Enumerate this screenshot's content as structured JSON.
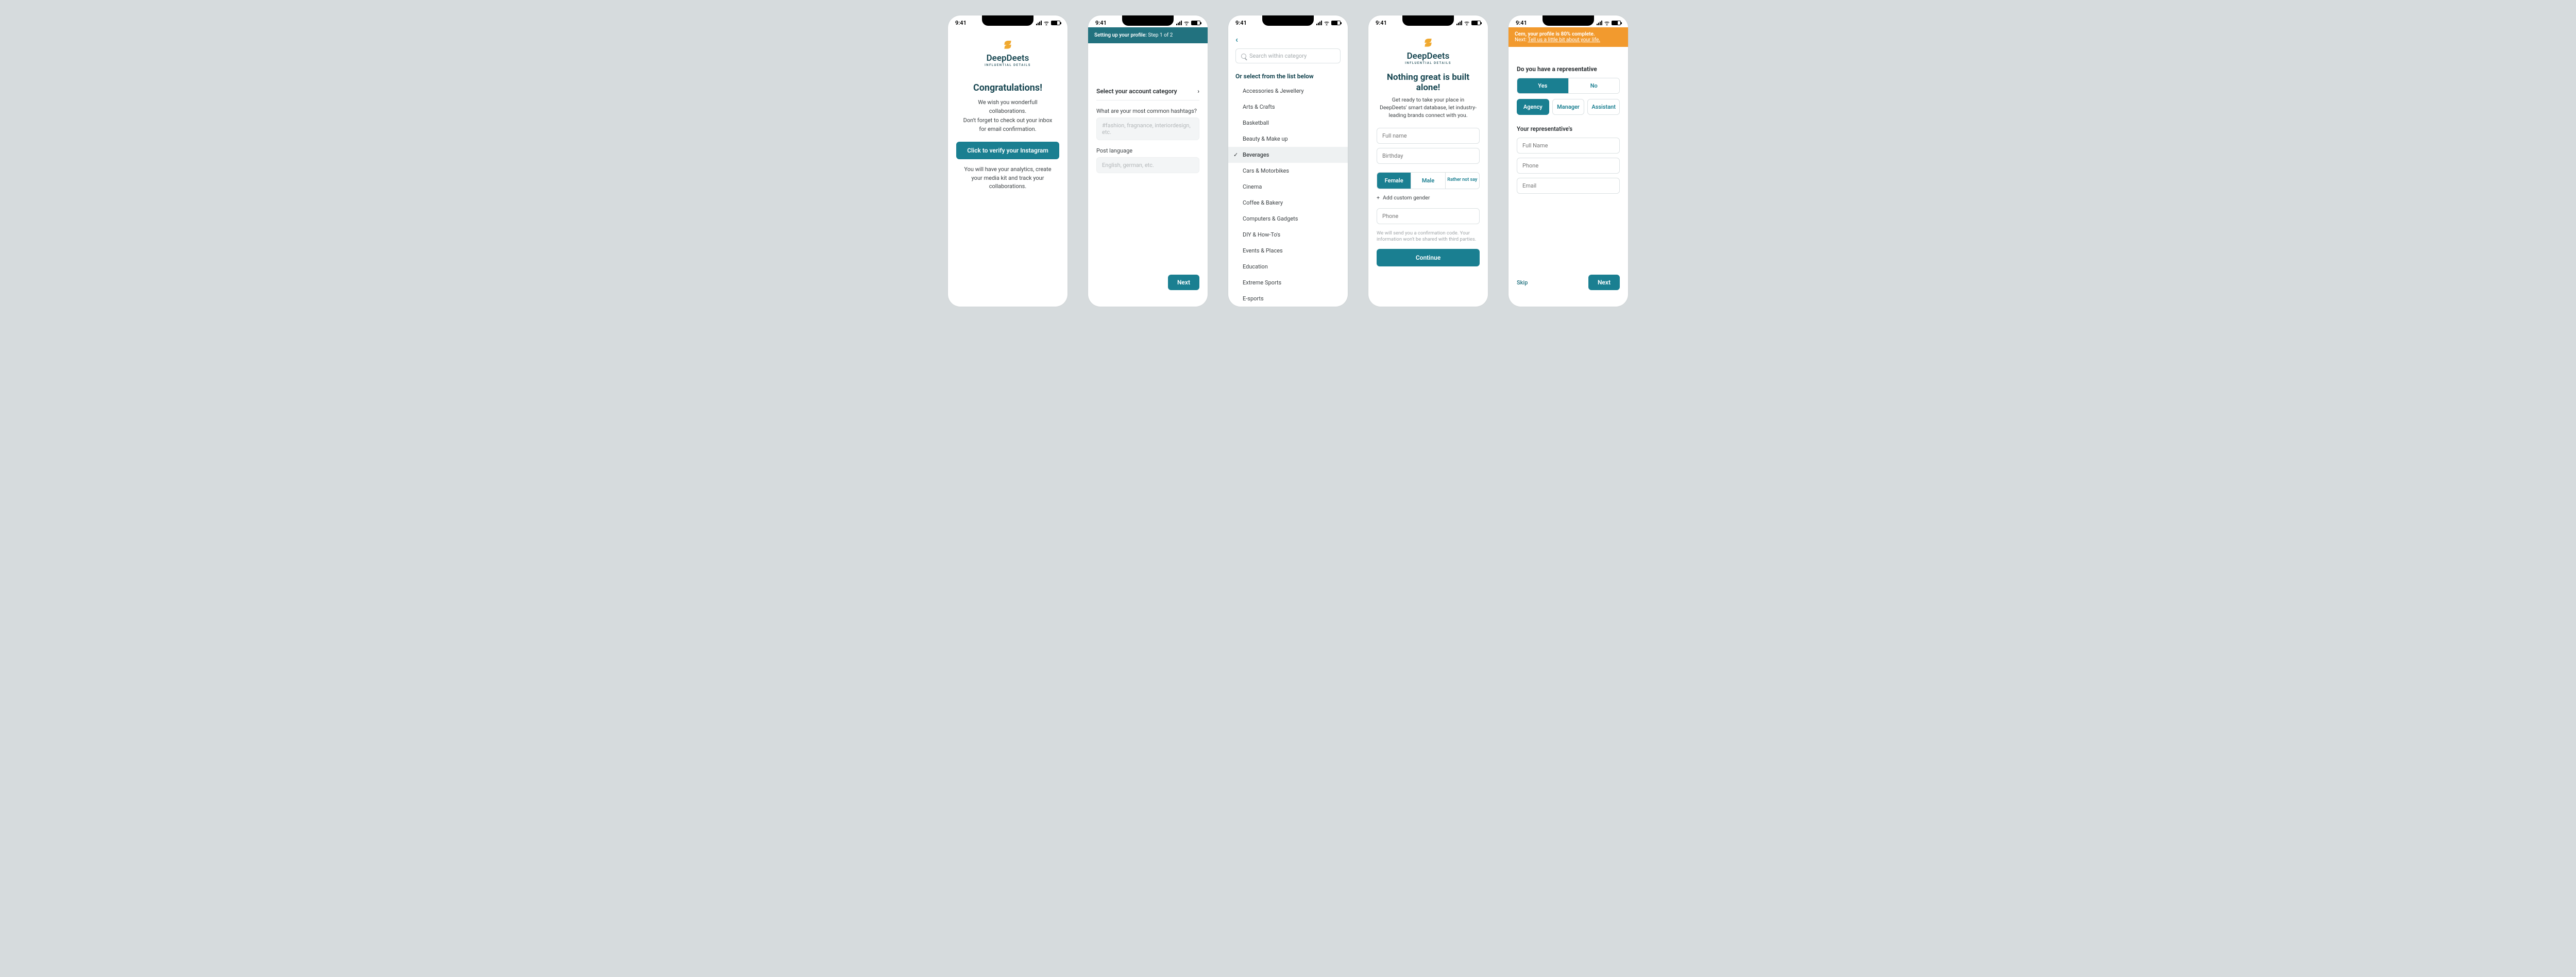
{
  "statusbar": {
    "time": "9:41"
  },
  "brand": {
    "name": "DeepDeets",
    "tagline": "INFLUENTIAL DETAILS"
  },
  "screen1": {
    "title": "Congratulations!",
    "line1": "We wish you wonderfull collaborations.",
    "line2": "Don't forget to check out your inbox for email confirmation.",
    "cta": "Click to verify your Instagram",
    "sub": "You will have your analytics, create your media kit and track your collaborations."
  },
  "screen2": {
    "bar_prefix": "Setting up your profile:",
    "bar_step": "Step 1 of 2",
    "row_label": "Select your account category",
    "hashtags_label": "What are your most common hashtags?",
    "hashtags_ph": "#fashion, fragnance, interiordesign, etc.",
    "lang_label": "Post language",
    "lang_ph": "English, german, etc.",
    "next": "Next"
  },
  "screen3": {
    "search_ph": "Search within category",
    "subhead": "Or select from the list below",
    "selected": "Beverages",
    "items": [
      "Accessories & Jewellery",
      "Arts & Crafts",
      "Basketball",
      "Beauty & Make up",
      "Beverages",
      "Cars & Motorbikes",
      "Cinema",
      "Coffee & Bakery",
      "Computers & Gadgets",
      "DIY & How-To's",
      "Events & Places",
      "Education",
      "Extreme Sports",
      "E-sports"
    ]
  },
  "screen4": {
    "title": "Nothing great is built alone!",
    "subtitle": "Get ready to take your place in DeepDeets' smart database, let industry-leading brands connect with you.",
    "fullname_ph": "Full name",
    "birthday_ph": "Birthday",
    "gender": {
      "female": "Female",
      "male": "Male",
      "rns": "Rather not say"
    },
    "add_gender": "Add custom gender",
    "phone_ph": "Phone",
    "hint": "We will send you a confirmation code. Your information won't be shared with third parties.",
    "continue": "Continue"
  },
  "screen5": {
    "banner_line1": "Cem, your profile is 80% complete.",
    "banner_next_prefix": "Next: ",
    "banner_next_link": "Tell us a little bit about your life.",
    "q1": "Do you have a representative",
    "yes": "Yes",
    "no": "No",
    "tabs": {
      "agency": "Agency",
      "manager": "Manager",
      "assistant": "Assistant"
    },
    "rep_label": "Your representative's",
    "fullname_ph": "Full Name",
    "phone_ph": "Phone",
    "email_ph": "Email",
    "skip": "Skip",
    "next": "Next"
  }
}
